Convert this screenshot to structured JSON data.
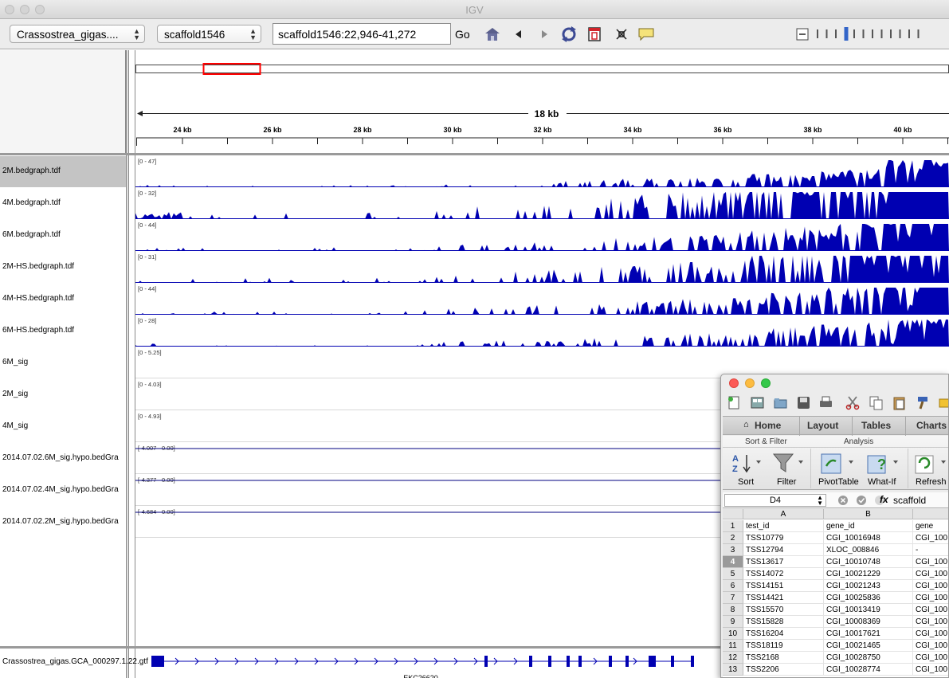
{
  "window": {
    "title": "IGV"
  },
  "toolbar": {
    "genome": "Crassostrea_gigas....",
    "chromosome": "scaffold1546",
    "locus": "scaffold1546:22,946-41,272",
    "go_label": "Go",
    "icons": [
      "home-icon",
      "back-arrow-icon",
      "forward-arrow-icon",
      "refresh-icon",
      "roi-icon",
      "resize-icon",
      "popup-text-icon"
    ],
    "zoom_level": 3
  },
  "ruler": {
    "span_label": "18 kb",
    "ticks": [
      "24 kb",
      "26 kb",
      "28 kb",
      "30 kb",
      "32 kb",
      "34 kb",
      "36 kb",
      "38 kb",
      "40 kb"
    ]
  },
  "tracks": [
    {
      "name": "2M.bedgraph.tdf",
      "range": "[0 - 47]",
      "selected": true
    },
    {
      "name": "4M.bedgraph.tdf",
      "range": "[0 - 32]"
    },
    {
      "name": "6M.bedgraph.tdf",
      "range": "[0 - 44]"
    },
    {
      "name": "2M-HS.bedgraph.tdf",
      "range": "[0 - 31]"
    },
    {
      "name": "4M-HS.bedgraph.tdf",
      "range": "[0 - 44]"
    },
    {
      "name": "6M-HS.bedgraph.tdf",
      "range": "[0 - 28]"
    },
    {
      "name": "6M_sig",
      "range": "[0 - 5.25]"
    },
    {
      "name": "2M_sig",
      "range": "[0 - 4.03]"
    },
    {
      "name": "4M_sig",
      "range": "[0 - 4.93]"
    },
    {
      "name": "2014.07.02.6M_sig.hypo.bedGra",
      "range": "[-4.007 - 0.00]"
    },
    {
      "name": "2014.07.02.4M_sig.hypo.bedGra",
      "range": "[-4.377 - 0.00]"
    },
    {
      "name": "2014.07.02.2M_sig.hypo.bedGra",
      "range": "[-4.684 - 0.00]"
    }
  ],
  "gene_track": {
    "name": "Crassostrea_gigas.GCA_000297.1.22.gtf",
    "feature_label": "EKC26620"
  },
  "colors": {
    "coverage": "#0000b2",
    "roi": "#ff0000",
    "selected_track": "#c4c4c4"
  },
  "excel": {
    "tabs": [
      "Home",
      "Layout",
      "Tables",
      "Charts"
    ],
    "groups": [
      "Sort & Filter",
      "Analysis"
    ],
    "ribbon_buttons": [
      "Sort",
      "Filter",
      "PivotTable",
      "What-If",
      "Refresh"
    ],
    "name_box": "D4",
    "formula_value": "scaffold",
    "fx_label": "fx",
    "columns": [
      "A",
      "B"
    ],
    "selected_row": 4,
    "rows": [
      {
        "n": "1",
        "a": "test_id",
        "b": "gene_id",
        "c": "gene"
      },
      {
        "n": "2",
        "a": "TSS10779",
        "b": "CGI_10016948",
        "c": "CGI_100"
      },
      {
        "n": "3",
        "a": "TSS12794",
        "b": "XLOC_008846",
        "c": "-"
      },
      {
        "n": "4",
        "a": "TSS13617",
        "b": "CGI_10010748",
        "c": "CGI_100"
      },
      {
        "n": "5",
        "a": "TSS14072",
        "b": "CGI_10021229",
        "c": "CGI_100"
      },
      {
        "n": "6",
        "a": "TSS14151",
        "b": "CGI_10021243",
        "c": "CGI_100"
      },
      {
        "n": "7",
        "a": "TSS14421",
        "b": "CGI_10025836",
        "c": "CGI_100"
      },
      {
        "n": "8",
        "a": "TSS15570",
        "b": "CGI_10013419",
        "c": "CGI_100"
      },
      {
        "n": "9",
        "a": "TSS15828",
        "b": "CGI_10008369",
        "c": "CGI_100"
      },
      {
        "n": "10",
        "a": "TSS16204",
        "b": "CGI_10017621",
        "c": "CGI_100"
      },
      {
        "n": "11",
        "a": "TSS18119",
        "b": "CGI_10021465",
        "c": "CGI_100"
      },
      {
        "n": "12",
        "a": "TSS2168",
        "b": "CGI_10028750",
        "c": "CGI_100"
      },
      {
        "n": "13",
        "a": "TSS2206",
        "b": "CGI_10028774",
        "c": "CGI_100"
      }
    ]
  }
}
